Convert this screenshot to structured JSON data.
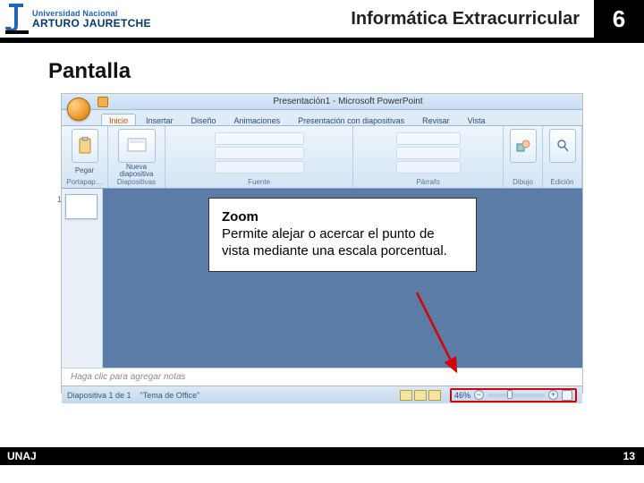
{
  "header": {
    "uni_top": "Universidad Nacional",
    "uni_bottom": "ARTURO JAURETCHE",
    "title": "Informática Extracurricular",
    "number": "6"
  },
  "section": {
    "title": "Pantalla"
  },
  "powerpoint": {
    "window_title": "Presentación1 - Microsoft PowerPoint",
    "tabs": {
      "inicio": "Inicio",
      "insertar": "Insertar",
      "diseno": "Diseño",
      "animaciones": "Animaciones",
      "presentacion": "Presentación con diapositivas",
      "revisar": "Revisar",
      "vista": "Vista"
    },
    "groups": {
      "pegar": "Pegar",
      "portapapeles": "Portapap…",
      "nueva": "Nueva\ndiapositiva",
      "diapositivas": "Diapositivas",
      "fuente": "Fuente",
      "parrafo": "Párrafo",
      "dibujo": "Dibujo",
      "edicion": "Edición"
    },
    "notes_placeholder": "Haga clic para agregar notas",
    "status": {
      "slide_of": "Diapositiva 1 de 1",
      "theme": "\"Tema de Office\"",
      "zoom_pct": "46%"
    }
  },
  "callout": {
    "title": "Zoom",
    "body": "Permite alejar o acercar el punto de vista mediante una escala porcentual."
  },
  "footer": {
    "left": "UNAJ",
    "right": "13"
  }
}
